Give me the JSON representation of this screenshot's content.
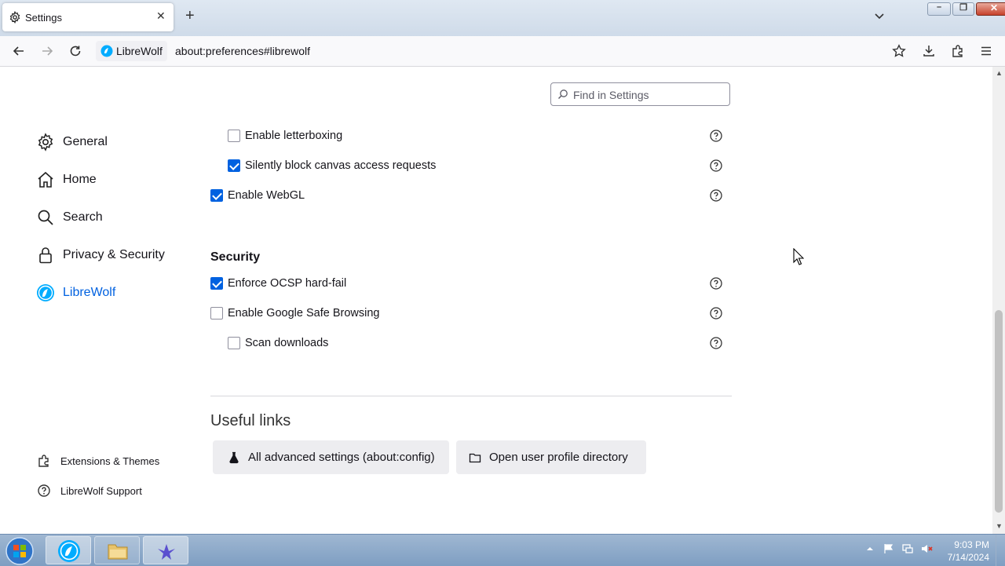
{
  "tab": {
    "title": "Settings",
    "close": "✕",
    "new_tab": "+"
  },
  "window_controls": {
    "minimize": "–",
    "maximize": "❐",
    "close": "✕"
  },
  "navbar": {
    "identity_label": "LibreWolf",
    "url": "about:preferences#librewolf"
  },
  "search": {
    "placeholder": "Find in Settings"
  },
  "sidebar": {
    "items": [
      {
        "label": "General",
        "icon": "gear-icon"
      },
      {
        "label": "Home",
        "icon": "home-icon"
      },
      {
        "label": "Search",
        "icon": "search-icon"
      },
      {
        "label": "Privacy & Security",
        "icon": "lock-icon"
      },
      {
        "label": "LibreWolf",
        "icon": "librewolf-icon",
        "selected": true
      }
    ],
    "footer": [
      {
        "label": "Extensions & Themes",
        "icon": "puzzle-icon"
      },
      {
        "label": "LibreWolf Support",
        "icon": "help-icon"
      }
    ]
  },
  "options": {
    "letterboxing": {
      "label": "Enable letterboxing",
      "checked": false
    },
    "canvas_block": {
      "label": "Silently block canvas access requests",
      "checked": true
    },
    "webgl": {
      "label": "Enable WebGL",
      "checked": true
    }
  },
  "security": {
    "title": "Security",
    "ocsp": {
      "label": "Enforce OCSP hard-fail",
      "checked": true
    },
    "safe_browsing": {
      "label": "Enable Google Safe Browsing",
      "checked": false
    },
    "scan_downloads": {
      "label": "Scan downloads",
      "checked": false
    }
  },
  "useful_links": {
    "title": "Useful links",
    "advanced": "All advanced settings (about:config)",
    "profile": "Open user profile directory"
  },
  "clock": {
    "time": "9:03 PM",
    "date": "7/14/2024"
  },
  "colors": {
    "accent": "#0061e0",
    "taskbar": "#8aa8c9"
  }
}
